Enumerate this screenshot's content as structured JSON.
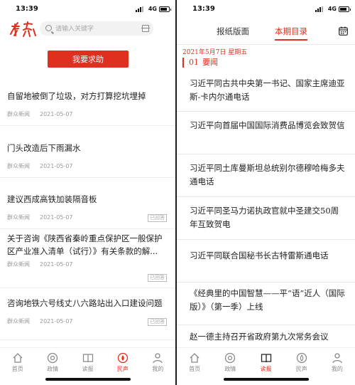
{
  "left": {
    "status": {
      "time": "13:39",
      "network": "4G"
    },
    "search": {
      "placeholder": "请输入关键字"
    },
    "help_button": "我要求助",
    "news": [
      {
        "title": "自留地被倒了垃圾，对方打算挖坑埋掉",
        "source": "群众新闻",
        "date": "2021-05-07",
        "stamp": ""
      },
      {
        "title": "门头改造后下雨漏水",
        "source": "群众新闻",
        "date": "2021-05-07",
        "stamp": ""
      },
      {
        "title": "建议西成高铁加装隔音板",
        "source": "群众新闻",
        "date": "2021-05-07",
        "stamp": "已回答"
      },
      {
        "title": "关于咨询《陕西省秦岭重点保护区一般保护区产业准入清单（试行）》有关条款的解...",
        "source": "群众新闻",
        "date": "2021-05-07",
        "stamp": "已回答"
      },
      {
        "title": "咨询地铁六号线丈八六路站出入口建设问题",
        "source": "群众新闻",
        "date": "2021-05-07",
        "stamp": "已回答"
      }
    ],
    "tabs": [
      {
        "label": "首页",
        "icon": "home-icon"
      },
      {
        "label": "政情",
        "icon": "politics-icon"
      },
      {
        "label": "读报",
        "icon": "newspaper-icon"
      },
      {
        "label": "民声",
        "icon": "voice-icon"
      },
      {
        "label": "我的",
        "icon": "profile-icon"
      }
    ],
    "active_tab": 3,
    "accent": "#e02e1f"
  },
  "right": {
    "status": {
      "time": "13:39",
      "network": "4G"
    },
    "tabs": {
      "layout": "报纸版面",
      "contents": "本期目录"
    },
    "date": "2021年5月7日 星期五",
    "section": {
      "number": "01",
      "name": "要闻"
    },
    "articles": [
      "习近平同古共中央第一书记、国家主席迪亚斯-卡内尔通电话",
      "习近平向首届中国国际消费品博览会致贺信",
      "习近平同土库曼斯坦总统别尔德穆哈梅多夫通电话",
      "习近平同圣马力诺执政官就中圣建交50周年互致贺电",
      "习近平同联合国秘书长古特雷斯通电话",
      "《经典里的中国智慧——平“语”近人（国际版）》（第一季）上线",
      "赵一德主持召开省政府第九次常务会议"
    ],
    "tab_bar": [
      {
        "label": "首页",
        "icon": "home-icon"
      },
      {
        "label": "政情",
        "icon": "politics-icon"
      },
      {
        "label": "读报",
        "icon": "newspaper-icon"
      },
      {
        "label": "民声",
        "icon": "voice-icon"
      },
      {
        "label": "我的",
        "icon": "profile-icon"
      }
    ],
    "active_tab": 2
  }
}
